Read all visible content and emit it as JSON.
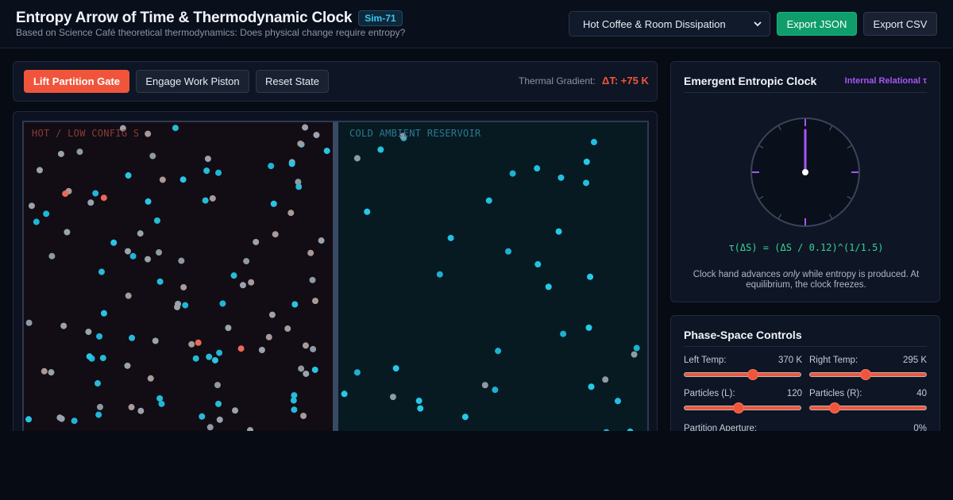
{
  "header": {
    "title": "Entropy Arrow of Time & Thermodynamic Clock",
    "badge": "Sim-71",
    "subtitle": "Based on Science Café theoretical thermodynamics: Does physical change require entropy?",
    "scenario_selected": "Hot Coffee & Room Dissipation",
    "export_json_label": "Export JSON",
    "export_csv_label": "Export CSV"
  },
  "toolbar": {
    "lift_label": "Lift Partition Gate",
    "piston_label": "Engage Work Piston",
    "reset_label": "Reset State",
    "gradient_label": "Thermal Gradient:",
    "gradient_value": "ΔT: +75 K"
  },
  "simulation": {
    "hot_label": "HOT / LOW CONFIG S",
    "cold_label": "COLD AMBIENT RESERVOIR"
  },
  "clock": {
    "title": "Emergent Entropic Clock",
    "tag": "Internal Relational τ",
    "formula": "τ(ΔS) = (ΔS / 0.12)^(1/1.5)",
    "note_before": "Clock hand advances ",
    "note_em": "only",
    "note_after": " while entropy is produced. At equilibrium, the clock freezes.",
    "hand_angle_deg": 0
  },
  "controls": {
    "title": "Phase-Space Controls",
    "left_temp_label": "Left Temp:",
    "left_temp_value": "370 K",
    "left_temp_fraction": 0.6,
    "right_temp_label": "Right Temp:",
    "right_temp_value": "295 K",
    "right_temp_fraction": 0.48,
    "particles_left_label": "Particles (L):",
    "particles_left_value": "120",
    "particles_left_fraction": 0.46,
    "particles_right_label": "Particles (R):",
    "particles_right_value": "40",
    "particles_right_fraction": 0.19,
    "aperture_label": "Partition Aperture:",
    "aperture_value": "0%"
  },
  "colors": {
    "accent": "#f0553c",
    "success": "#0f9d6c",
    "clock_purple": "#a855f7",
    "formula_green": "#34d399",
    "particle_cyan": "#22d3ee",
    "particle_gray": "#9aa3ad"
  }
}
